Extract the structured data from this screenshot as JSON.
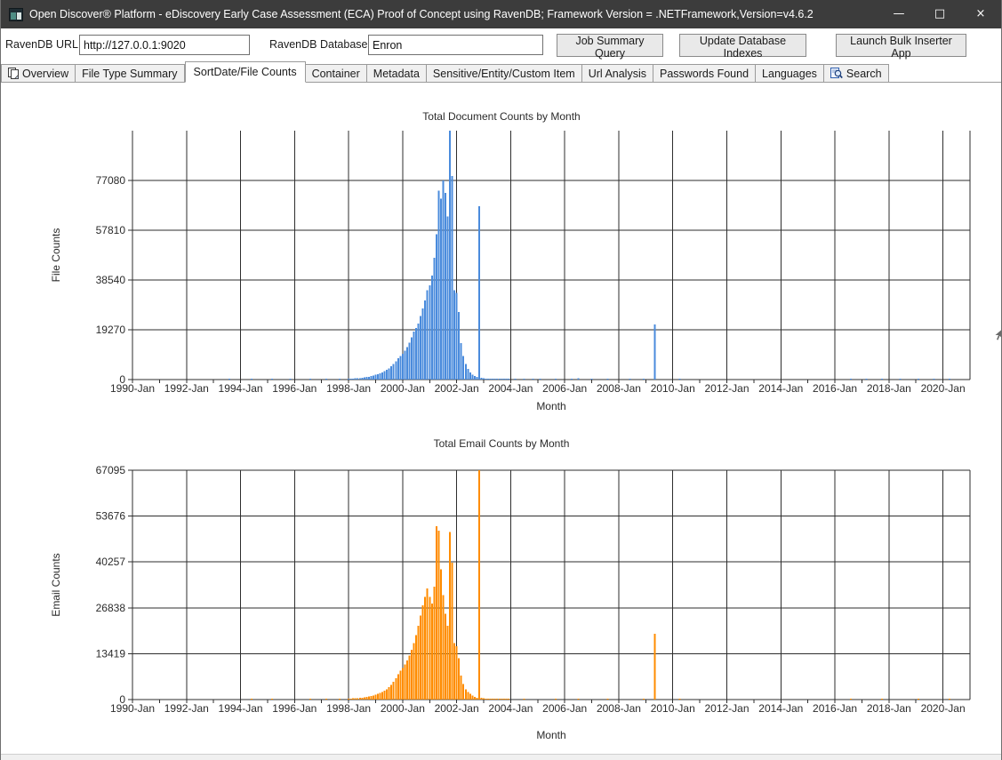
{
  "window": {
    "title": "Open Discover® Platform - eDiscovery Early Case Assessment (ECA) Proof of Concept using RavenDB;   Framework Version = .NETFramework,Version=v4.6.2",
    "controls": {
      "minimize": "—",
      "maximize": "□",
      "close": "×"
    }
  },
  "toolbar": {
    "url_label": "RavenDB URL:",
    "url_value": "http://127.0.0.1:9020",
    "db_label": "RavenDB Database:",
    "db_value": "Enron",
    "buttons": [
      {
        "label": "Job Summary Query"
      },
      {
        "label": "Update Database Indexes"
      },
      {
        "label": "Launch Bulk Inserter App"
      }
    ]
  },
  "tabs": [
    {
      "label": "Overview",
      "icon": "copy-page-icon"
    },
    {
      "label": "File Type Summary"
    },
    {
      "label": "SortDate/File Counts",
      "selected": true
    },
    {
      "label": "Container"
    },
    {
      "label": "Metadata"
    },
    {
      "label": "Sensitive/Entity/Custom Item"
    },
    {
      "label": "Url Analysis"
    },
    {
      "label": "Passwords Found"
    },
    {
      "label": "Languages"
    },
    {
      "label": "Search",
      "icon": "search-icon"
    }
  ],
  "chart_data": [
    {
      "type": "bar",
      "title": "Total Document Counts by Month",
      "xlabel": "Month",
      "ylabel": "File Counts",
      "bar_color": "#4a8bdc",
      "grid_color": "#2e2e2e",
      "yticks": [
        0,
        19270,
        38540,
        57810,
        77080
      ],
      "ymax": 96350,
      "x_start_year": 1990,
      "x_end_year": 2021,
      "xtick_labels": [
        "1990-Jan",
        "1992-Jan",
        "1994-Jan",
        "1996-Jan",
        "1998-Jan",
        "2000-Jan",
        "2002-Jan",
        "2004-Jan",
        "2006-Jan",
        "2008-Jan",
        "2010-Jan",
        "2012-Jan",
        "2014-Jan",
        "2016-Jan",
        "2018-Jan",
        "2020-Jan"
      ],
      "xtick_interval_years": 2,
      "minor_tick_years": 1,
      "grid": true,
      "values": [
        [
          "1993-08",
          250
        ],
        [
          "1994-06",
          300
        ],
        [
          "1995-03",
          250
        ],
        [
          "1995-11",
          280
        ],
        [
          "1996-08",
          300
        ],
        [
          "1997-03",
          350
        ],
        [
          "1997-09",
          420
        ],
        [
          "1998-01",
          350
        ],
        [
          "1998-02",
          300
        ],
        [
          "1998-03",
          400
        ],
        [
          "1998-04",
          450
        ],
        [
          "1998-05",
          520
        ],
        [
          "1998-06",
          600
        ],
        [
          "1998-07",
          700
        ],
        [
          "1998-08",
          820
        ],
        [
          "1998-09",
          950
        ],
        [
          "1998-10",
          1100
        ],
        [
          "1998-11",
          1300
        ],
        [
          "1998-12",
          1600
        ],
        [
          "1999-01",
          1900
        ],
        [
          "1999-02",
          2100
        ],
        [
          "1999-03",
          2400
        ],
        [
          "1999-04",
          2800
        ],
        [
          "1999-05",
          3200
        ],
        [
          "1999-06",
          3700
        ],
        [
          "1999-07",
          4300
        ],
        [
          "1999-08",
          5100
        ],
        [
          "1999-09",
          6000
        ],
        [
          "1999-10",
          7100
        ],
        [
          "1999-11",
          8200
        ],
        [
          "1999-12",
          9200
        ],
        [
          "2000-01",
          9900
        ],
        [
          "2000-02",
          11200
        ],
        [
          "2000-03",
          12600
        ],
        [
          "2000-04",
          14300
        ],
        [
          "2000-05",
          16300
        ],
        [
          "2000-06",
          18500
        ],
        [
          "2000-07",
          19900
        ],
        [
          "2000-08",
          21600
        ],
        [
          "2000-09",
          24600
        ],
        [
          "2000-10",
          27600
        ],
        [
          "2000-11",
          30600
        ],
        [
          "2000-12",
          34600
        ],
        [
          "2001-01",
          36500
        ],
        [
          "2001-02",
          40200
        ],
        [
          "2001-03",
          47200
        ],
        [
          "2001-04",
          56200
        ],
        [
          "2001-05",
          73200
        ],
        [
          "2001-06",
          70100
        ],
        [
          "2001-07",
          77080
        ],
        [
          "2001-08",
          72200
        ],
        [
          "2001-09",
          63200
        ],
        [
          "2001-10",
          96350
        ],
        [
          "2001-11",
          78800
        ],
        [
          "2001-12",
          34600
        ],
        [
          "2002-01",
          33600
        ],
        [
          "2002-02",
          26100
        ],
        [
          "2002-03",
          14100
        ],
        [
          "2002-04",
          9100
        ],
        [
          "2002-05",
          6100
        ],
        [
          "2002-06",
          4100
        ],
        [
          "2002-07",
          2700
        ],
        [
          "2002-08",
          1900
        ],
        [
          "2002-09",
          1350
        ],
        [
          "2002-10",
          950
        ],
        [
          "2002-11",
          67095
        ],
        [
          "2002-12",
          720
        ],
        [
          "2003-01",
          520
        ],
        [
          "2003-02",
          420
        ],
        [
          "2003-03",
          320
        ],
        [
          "2003-04",
          260
        ],
        [
          "2003-05",
          210
        ],
        [
          "2003-06",
          185
        ],
        [
          "2003-07",
          155
        ],
        [
          "2003-08",
          135
        ],
        [
          "2003-09",
          115
        ],
        [
          "2003-10",
          100
        ],
        [
          "2003-11",
          90
        ],
        [
          "2003-12",
          80
        ],
        [
          "2004-03",
          150
        ],
        [
          "2004-07",
          130
        ],
        [
          "2004-11",
          160
        ],
        [
          "2005-02",
          110
        ],
        [
          "2005-09",
          140
        ],
        [
          "2006-04",
          160
        ],
        [
          "2006-07",
          450
        ],
        [
          "2007-01",
          130
        ],
        [
          "2007-08",
          110
        ],
        [
          "2008-06",
          160
        ],
        [
          "2008-12",
          220
        ],
        [
          "2009-05",
          21300
        ],
        [
          "2010-04",
          150
        ],
        [
          "2016-08",
          160
        ],
        [
          "2017-03",
          130
        ],
        [
          "2017-10",
          150
        ],
        [
          "2018-06",
          140
        ],
        [
          "2019-02",
          160
        ],
        [
          "2019-09",
          130
        ],
        [
          "2020-04",
          110
        ]
      ]
    },
    {
      "type": "bar",
      "title": "Total Email Counts by Month",
      "xlabel": "Month",
      "ylabel": "Email Counts",
      "bar_color": "#ff8c00",
      "grid_color": "#2e2e2e",
      "yticks": [
        0,
        13419,
        26838,
        40257,
        53676,
        67095
      ],
      "ymax": 67095,
      "x_start_year": 1990,
      "x_end_year": 2021,
      "xtick_labels": [
        "1990-Jan",
        "1992-Jan",
        "1994-Jan",
        "1996-Jan",
        "1998-Jan",
        "2000-Jan",
        "2002-Jan",
        "2004-Jan",
        "2006-Jan",
        "2008-Jan",
        "2010-Jan",
        "2012-Jan",
        "2014-Jan",
        "2016-Jan",
        "2018-Jan",
        "2020-Jan"
      ],
      "xtick_interval_years": 2,
      "minor_tick_years": 1,
      "grid": true,
      "values": [
        [
          "1994-06",
          150
        ],
        [
          "1995-03",
          130
        ],
        [
          "1996-08",
          160
        ],
        [
          "1997-03",
          210
        ],
        [
          "1997-09",
          260
        ],
        [
          "1998-01",
          260
        ],
        [
          "1998-02",
          290
        ],
        [
          "1998-03",
          330
        ],
        [
          "1998-04",
          370
        ],
        [
          "1998-05",
          430
        ],
        [
          "1998-06",
          490
        ],
        [
          "1998-07",
          570
        ],
        [
          "1998-08",
          660
        ],
        [
          "1998-09",
          770
        ],
        [
          "1998-10",
          890
        ],
        [
          "1998-11",
          1020
        ],
        [
          "1998-12",
          1220
        ],
        [
          "1999-01",
          1420
        ],
        [
          "1999-02",
          1660
        ],
        [
          "1999-03",
          1920
        ],
        [
          "1999-04",
          2230
        ],
        [
          "1999-05",
          2610
        ],
        [
          "1999-06",
          3040
        ],
        [
          "1999-07",
          3620
        ],
        [
          "1999-08",
          4320
        ],
        [
          "1999-09",
          5210
        ],
        [
          "1999-10",
          6210
        ],
        [
          "1999-11",
          7410
        ],
        [
          "1999-12",
          8420
        ],
        [
          "2000-01",
          9240
        ],
        [
          "2000-02",
          10240
        ],
        [
          "2000-03",
          11430
        ],
        [
          "2000-04",
          12840
        ],
        [
          "2000-05",
          14560
        ],
        [
          "2000-06",
          16540
        ],
        [
          "2000-07",
          18830
        ],
        [
          "2000-08",
          21540
        ],
        [
          "2000-09",
          24530
        ],
        [
          "2000-10",
          27520
        ],
        [
          "2000-11",
          30040
        ],
        [
          "2000-12",
          32530
        ],
        [
          "2001-01",
          30050
        ],
        [
          "2001-02",
          28040
        ],
        [
          "2001-03",
          33060
        ],
        [
          "2001-04",
          50740
        ],
        [
          "2001-05",
          49420
        ],
        [
          "2001-06",
          38060
        ],
        [
          "2001-07",
          30540
        ],
        [
          "2001-08",
          25060
        ],
        [
          "2001-09",
          21540
        ],
        [
          "2001-10",
          49040
        ],
        [
          "2001-11",
          40060
        ],
        [
          "2001-12",
          16540
        ],
        [
          "2002-01",
          15540
        ],
        [
          "2002-02",
          12040
        ],
        [
          "2002-03",
          7060
        ],
        [
          "2002-04",
          4540
        ],
        [
          "2002-05",
          3040
        ],
        [
          "2002-06",
          2240
        ],
        [
          "2002-07",
          1640
        ],
        [
          "2002-08",
          1140
        ],
        [
          "2002-09",
          820
        ],
        [
          "2002-10",
          560
        ],
        [
          "2002-11",
          67095
        ],
        [
          "2002-12",
          460
        ],
        [
          "2003-01",
          360
        ],
        [
          "2003-02",
          290
        ],
        [
          "2003-03",
          230
        ],
        [
          "2003-04",
          190
        ],
        [
          "2003-05",
          160
        ],
        [
          "2003-06",
          135
        ],
        [
          "2003-07",
          115
        ],
        [
          "2003-08",
          100
        ],
        [
          "2003-09",
          88
        ],
        [
          "2003-10",
          78
        ],
        [
          "2003-11",
          68
        ],
        [
          "2003-12",
          60
        ],
        [
          "2004-07",
          110
        ],
        [
          "2005-09",
          95
        ],
        [
          "2006-07",
          320
        ],
        [
          "2007-08",
          85
        ],
        [
          "2008-12",
          130
        ],
        [
          "2009-05",
          19250
        ],
        [
          "2010-04",
          90
        ],
        [
          "2016-08",
          110
        ],
        [
          "2017-10",
          95
        ],
        [
          "2019-02",
          105
        ],
        [
          "2020-04",
          85
        ]
      ]
    }
  ]
}
